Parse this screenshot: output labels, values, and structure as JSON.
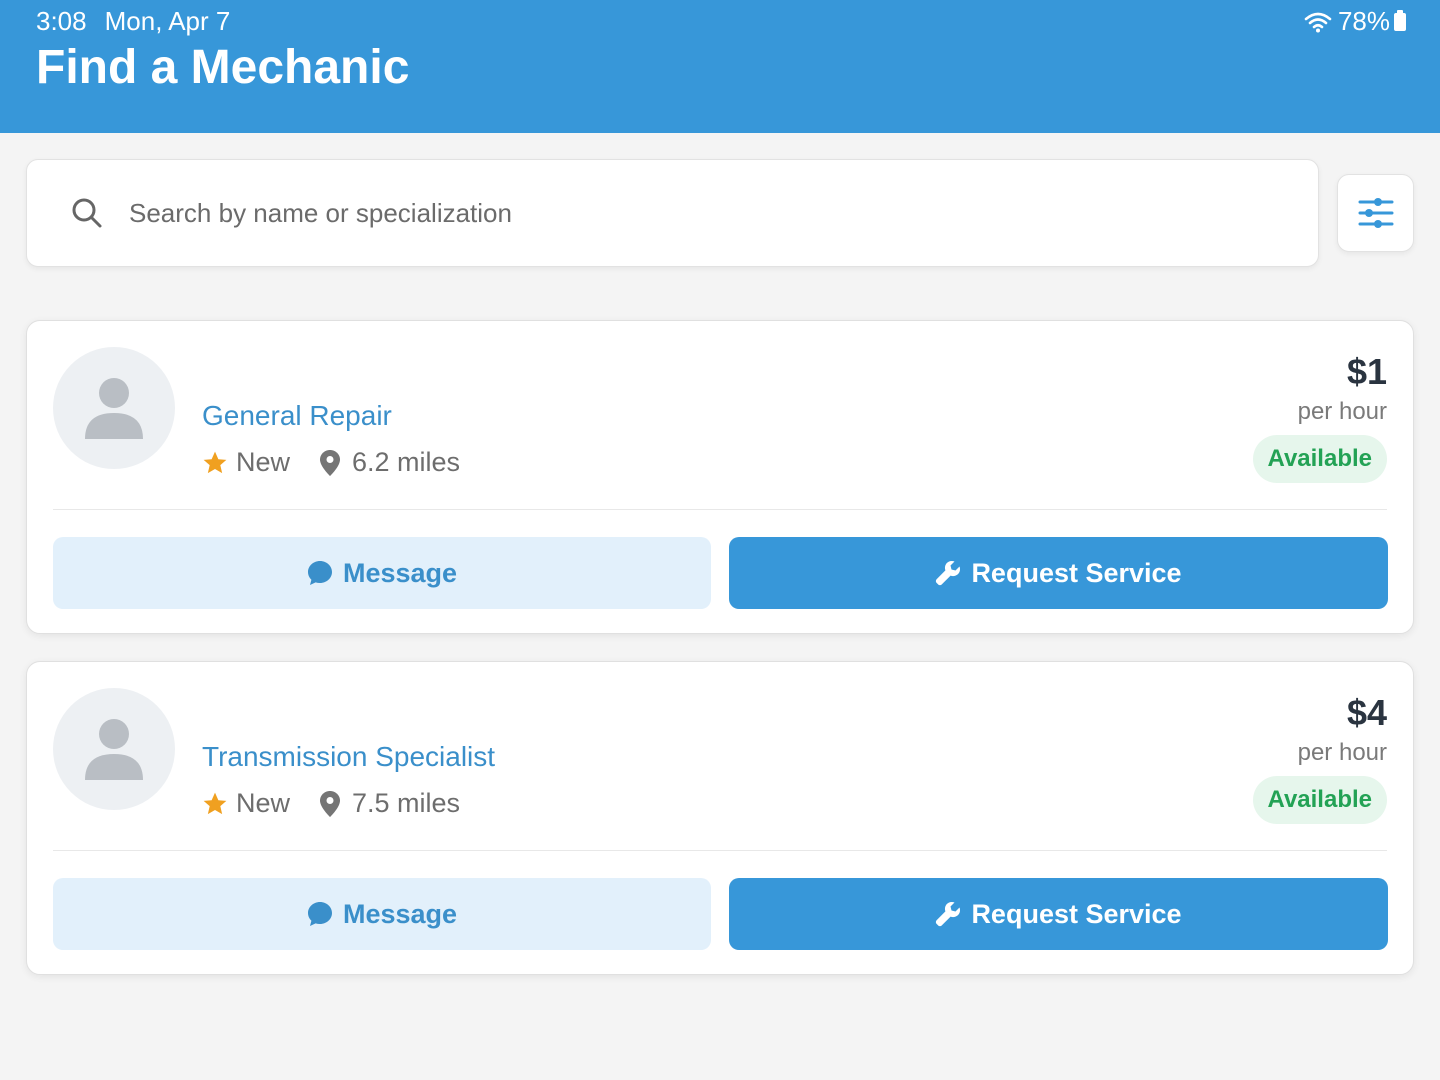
{
  "status_bar": {
    "time": "3:08",
    "date": "Mon, Apr 7",
    "battery": "78%"
  },
  "header": {
    "title": "Find a Mechanic"
  },
  "search": {
    "placeholder": "Search by name or specialization",
    "value": ""
  },
  "mechanics": [
    {
      "name": "General Repair",
      "rating": "New",
      "distance": "6.2 miles",
      "price": "$1",
      "price_unit": "per hour",
      "status": "Available",
      "message_label": "Message",
      "request_label": "Request Service"
    },
    {
      "name": "Transmission Specialist",
      "rating": "New",
      "distance": "7.5 miles",
      "price": "$4",
      "price_unit": "per hour",
      "status": "Available",
      "message_label": "Message",
      "request_label": "Request Service"
    }
  ],
  "icons": {
    "search": "search-icon",
    "filter": "sliders-icon",
    "star": "star-icon",
    "location": "map-pin-icon",
    "message": "chat-bubble-icon",
    "request": "wrench-icon",
    "avatar": "person-icon"
  },
  "colors": {
    "primary": "#3797d9",
    "star": "#f0a020",
    "available_text": "#23a255",
    "available_bg": "#e6f6ec",
    "message_bg": "#e2f0fb"
  }
}
